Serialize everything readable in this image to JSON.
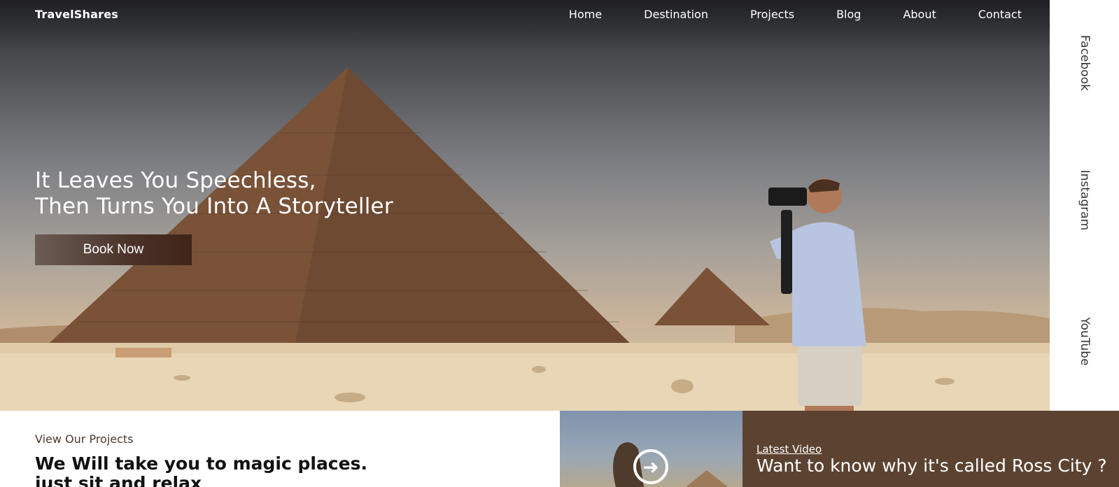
{
  "brand": {
    "name": "TravelShares"
  },
  "nav": {
    "items": [
      "Home",
      "Destination",
      "Projects",
      "Blog",
      "About",
      "Contact"
    ]
  },
  "hero": {
    "headline_line1": "It Leaves You Speechless,",
    "headline_line2": "Then Turns You Into A Storyteller",
    "cta_label": "Book Now"
  },
  "social": {
    "items": [
      "Facebook",
      "Instagram",
      "YouTube"
    ]
  },
  "projects": {
    "eyebrow": "View Our Projects",
    "title_line1": "We Will take you to magic places.",
    "title_line2": "just sit and relax"
  },
  "video": {
    "label": "Latest Video",
    "title": "Want to know why it's called Ross City ?",
    "play_icon": "play-circle-icon"
  },
  "colors": {
    "accent_brown": "#5c4331",
    "button_dark": "#3f2419"
  }
}
